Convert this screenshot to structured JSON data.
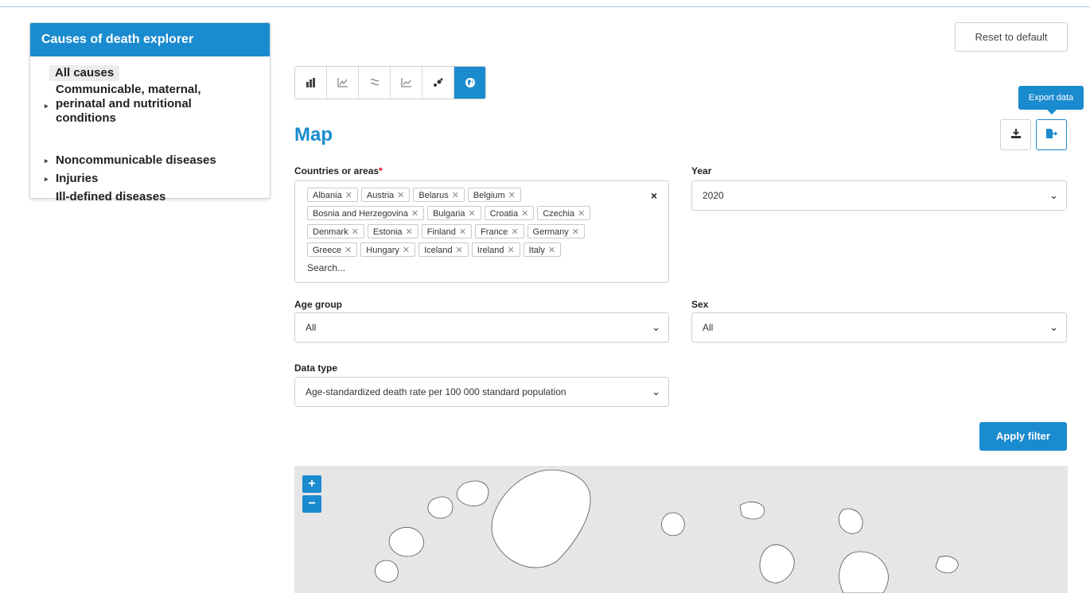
{
  "sidebar": {
    "title": "Causes of death explorer",
    "items": [
      {
        "label": "All causes",
        "expandable": false
      },
      {
        "label": "Communicable, maternal, perinatal and nutritional conditions",
        "expandable": true
      },
      {
        "label": "Noncommunicable diseases",
        "expandable": true
      },
      {
        "label": "Injuries",
        "expandable": true
      },
      {
        "label": "Ill-defined diseases",
        "expandable": false
      }
    ],
    "communicable_lines": [
      "Communicable, maternal,",
      "perinatal and nutritional",
      "conditions"
    ]
  },
  "header": {
    "reset_label": "Reset to default",
    "title": "Map",
    "export_tooltip": "Export data"
  },
  "toolbar": {
    "buttons": [
      {
        "icon": "bar-chart-icon",
        "glyph": "▮▮"
      },
      {
        "icon": "line-chart-icon",
        "glyph": "⩘"
      },
      {
        "icon": "pattern-icon",
        "glyph": "ঌ"
      },
      {
        "icon": "area-chart-icon",
        "glyph": "⩘"
      },
      {
        "icon": "scatter-icon",
        "glyph": "•⁘"
      },
      {
        "icon": "globe-icon",
        "glyph": "⊕",
        "active": true
      }
    ]
  },
  "filters": {
    "countries": {
      "label": "Countries or areas",
      "required_mark": "*",
      "selected": [
        "Albania",
        "Austria",
        "Belarus",
        "Belgium",
        "Bosnia and Herzegovina",
        "Bulgaria",
        "Croatia",
        "Czechia",
        "Denmark",
        "Estonia",
        "Finland",
        "France",
        "Germany",
        "Greece",
        "Hungary",
        "Iceland",
        "Ireland",
        "Italy"
      ],
      "search_placeholder": "Search...",
      "clear_glyph": "×"
    },
    "year": {
      "label": "Year",
      "value": "2020"
    },
    "age_group": {
      "label": "Age group",
      "value": "All"
    },
    "sex": {
      "label": "Sex",
      "value": "All"
    },
    "data_type": {
      "label": "Data type",
      "value": "Age-standardized death rate per 100 000 standard population"
    },
    "apply_label": "Apply filter"
  },
  "map": {
    "zoom_in": "+",
    "zoom_out": "−"
  },
  "colors": {
    "accent": "#1b8bcf",
    "map_background": "#e6e6e6"
  }
}
